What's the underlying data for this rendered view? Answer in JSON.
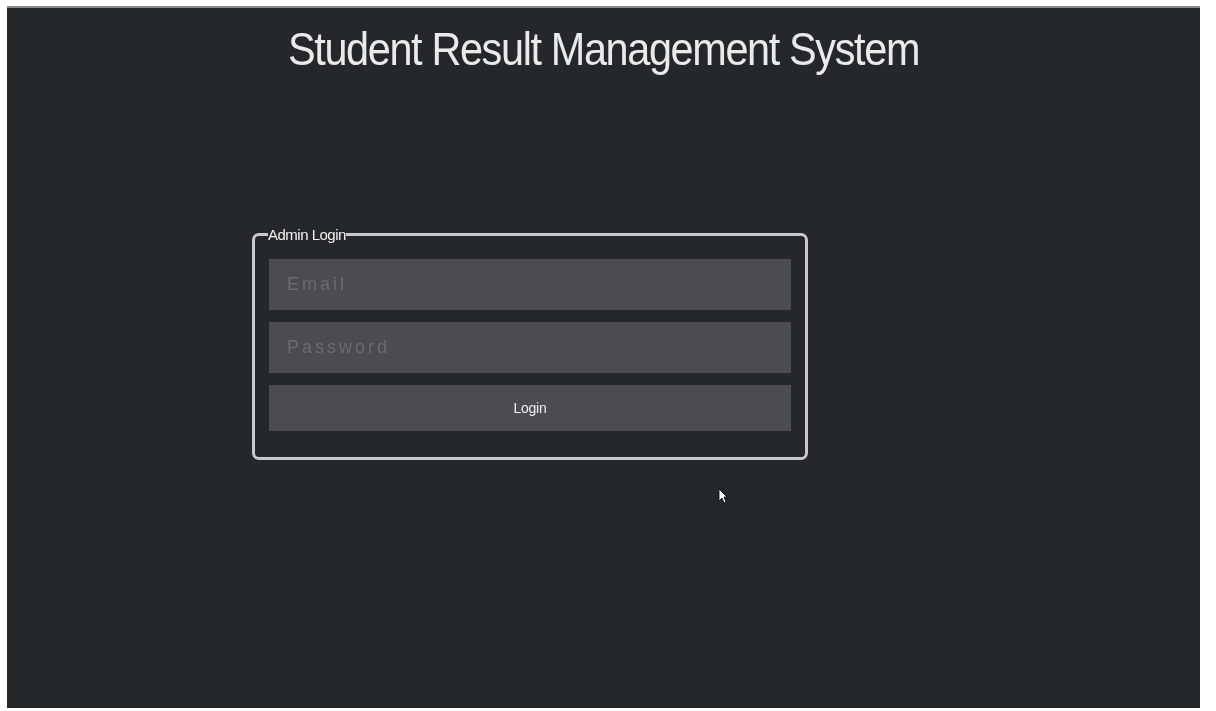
{
  "title": "Student Result Management System",
  "login": {
    "legend": "Admin Login",
    "fields": [
      {
        "placeholder": "Email"
      },
      {
        "placeholder": "Password"
      }
    ],
    "button": "Login"
  }
}
